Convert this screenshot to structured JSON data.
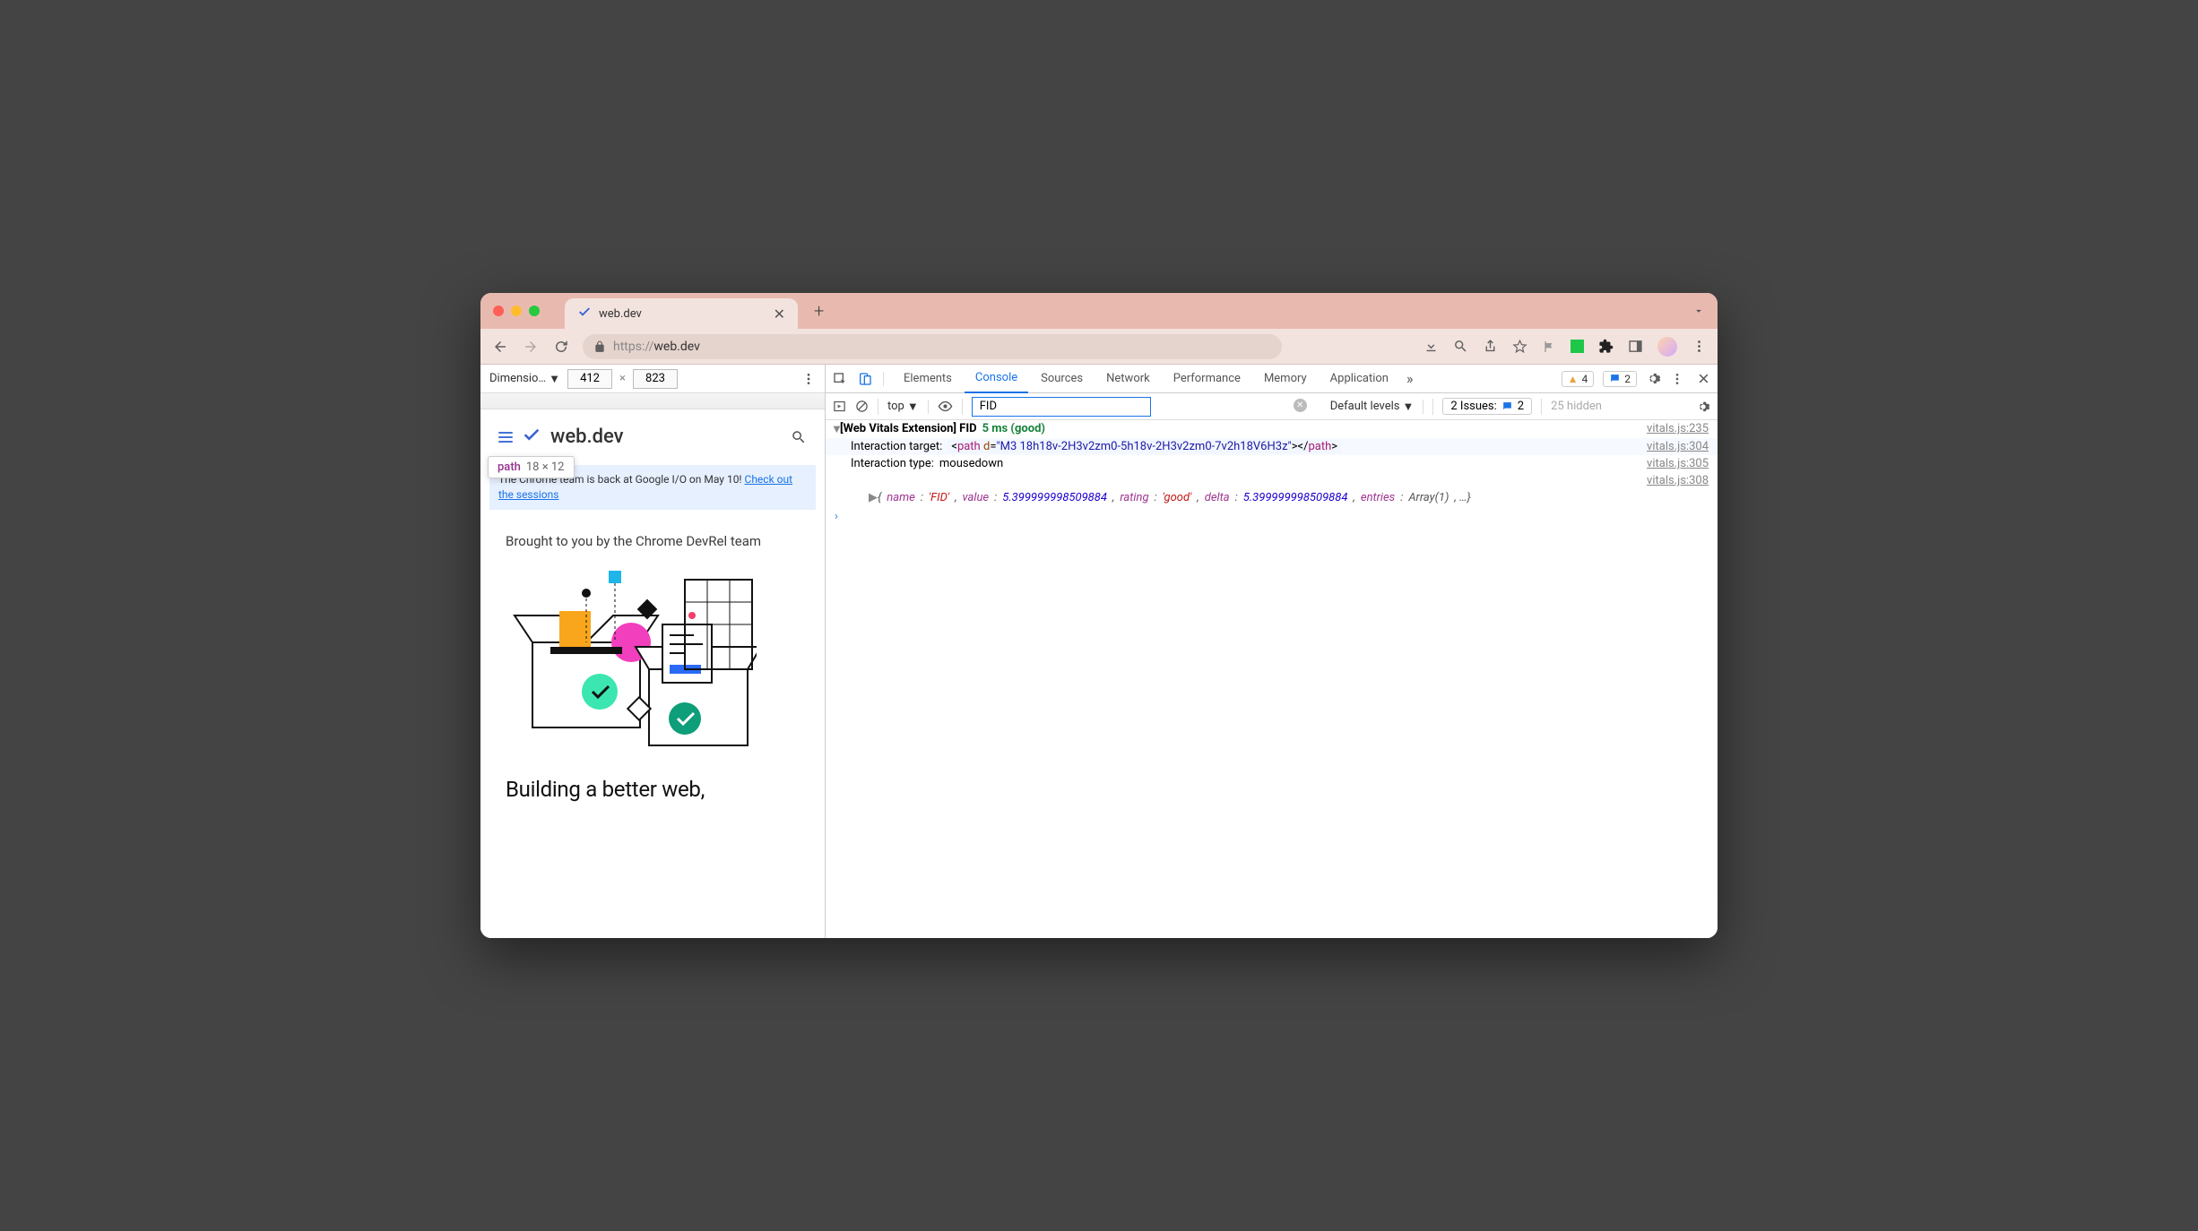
{
  "browser": {
    "tab_title": "web.dev",
    "url": "https://web.dev",
    "url_prefix": "https://"
  },
  "device_toolbar": {
    "label": "Dimensio…",
    "width": "412",
    "height": "823"
  },
  "page_preview": {
    "logo_text": "web.dev",
    "tooltip_tag": "path",
    "tooltip_dims": "18 × 12",
    "banner_text": "The Chrome team is back at Google I/O on May 10! ",
    "banner_link": "Check out the sessions",
    "brought_by": "Brought to you by the Chrome DevRel team",
    "hero": "Building a better web,"
  },
  "devtools": {
    "tabs": [
      "Elements",
      "Console",
      "Sources",
      "Network",
      "Performance",
      "Memory",
      "Application"
    ],
    "active_tab": "Console",
    "warnings_count": "4",
    "messages_count": "2",
    "console": {
      "context": "top",
      "filter_value": "FID",
      "levels_label": "Default levels",
      "issues_label": "2 Issues:",
      "issues_count": "2",
      "hidden_label": "25 hidden"
    },
    "log": {
      "l1_prefix": "[Web Vitals Extension] FID",
      "l1_value": "5 ms (good)",
      "l1_source": "vitals.js:235",
      "l2_label": "Interaction target:",
      "l2_tag": "path",
      "l2_attr": "d",
      "l2_val": "M3 18h18v-2H3v2zm0-5h18v-2H3v2zm0-7v2h18V6H3z",
      "l2_source": "vitals.js:304",
      "l3_label": "Interaction type:",
      "l3_value": "mousedown",
      "l3_source": "vitals.js:305",
      "l4_source": "vitals.js:308",
      "l4_obj_name": "'FID'",
      "l4_obj_value": "5.399999998509884",
      "l4_obj_rating": "'good'",
      "l4_obj_delta": "5.399999998509884",
      "l4_obj_entries": "Array(1)"
    }
  }
}
